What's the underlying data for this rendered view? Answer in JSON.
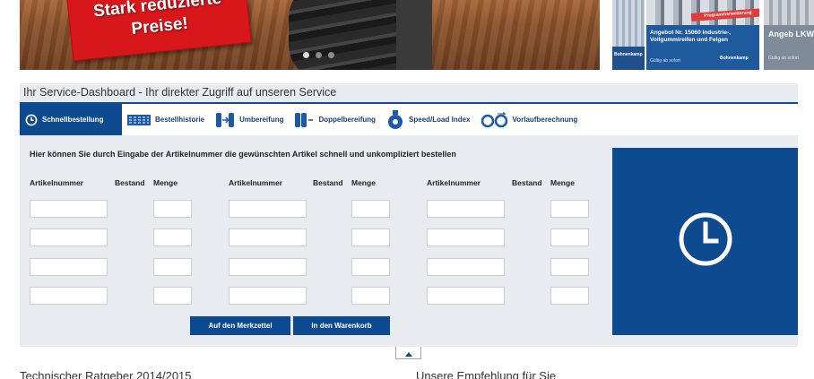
{
  "banner": {
    "promo_text": "Stark reduzierte Preise!",
    "slider_dots": 3,
    "ads": [
      {
        "text": "Bohnenkamp",
        "icon": "tyre-image"
      },
      {
        "ribbon": "Programmerweiterung",
        "title": "Angebot Nr. 15060 Industrie-, Vollgummireifen und Felgen",
        "sub": "Gültig ab sofort",
        "logo": "Bohnenkamp",
        "icon": "tyre-image"
      },
      {
        "title": "Angeb LKW-R",
        "sub": "Gültig ab sofort",
        "icon": "tyre-image"
      }
    ]
  },
  "dashboard": {
    "title": "Ihr Service-Dashboard - Ihr direkter Zugriff auf unseren Service",
    "tabs": [
      {
        "label": "Schnellbestellung",
        "icon": "clock-icon",
        "active": true
      },
      {
        "label": "Bestellhistorie",
        "icon": "tyre-tread-icon",
        "active": false
      },
      {
        "label": "Umbereifung",
        "icon": "tyre-change-icon",
        "active": false
      },
      {
        "label": "Doppelbereifung",
        "icon": "double-tyre-icon",
        "active": false
      },
      {
        "label": "Speed/Load Index",
        "icon": "tyre-index-icon",
        "active": false
      },
      {
        "label": "Vorlaufberechnung",
        "icon": "rollout-icon",
        "active": false
      }
    ],
    "quick_order": {
      "intro": "Hier können Sie durch Eingabe der Artikelnummer die gewünschten Artikel schnell und unkompliziert bestellen",
      "columns": {
        "article": "Artikelnummer",
        "stock": "Bestand",
        "quantity": "Menge"
      },
      "groups": 3,
      "rows": 4,
      "merkzettel_button": "Auf den Merkzettel",
      "cart_button": "In den Warenkorb"
    },
    "accent_color": "#0d4a8f"
  },
  "footer_sections": {
    "left": "Technischer Ratgeber 2014/2015",
    "right": "Unsere Empfehlung für Sie"
  }
}
